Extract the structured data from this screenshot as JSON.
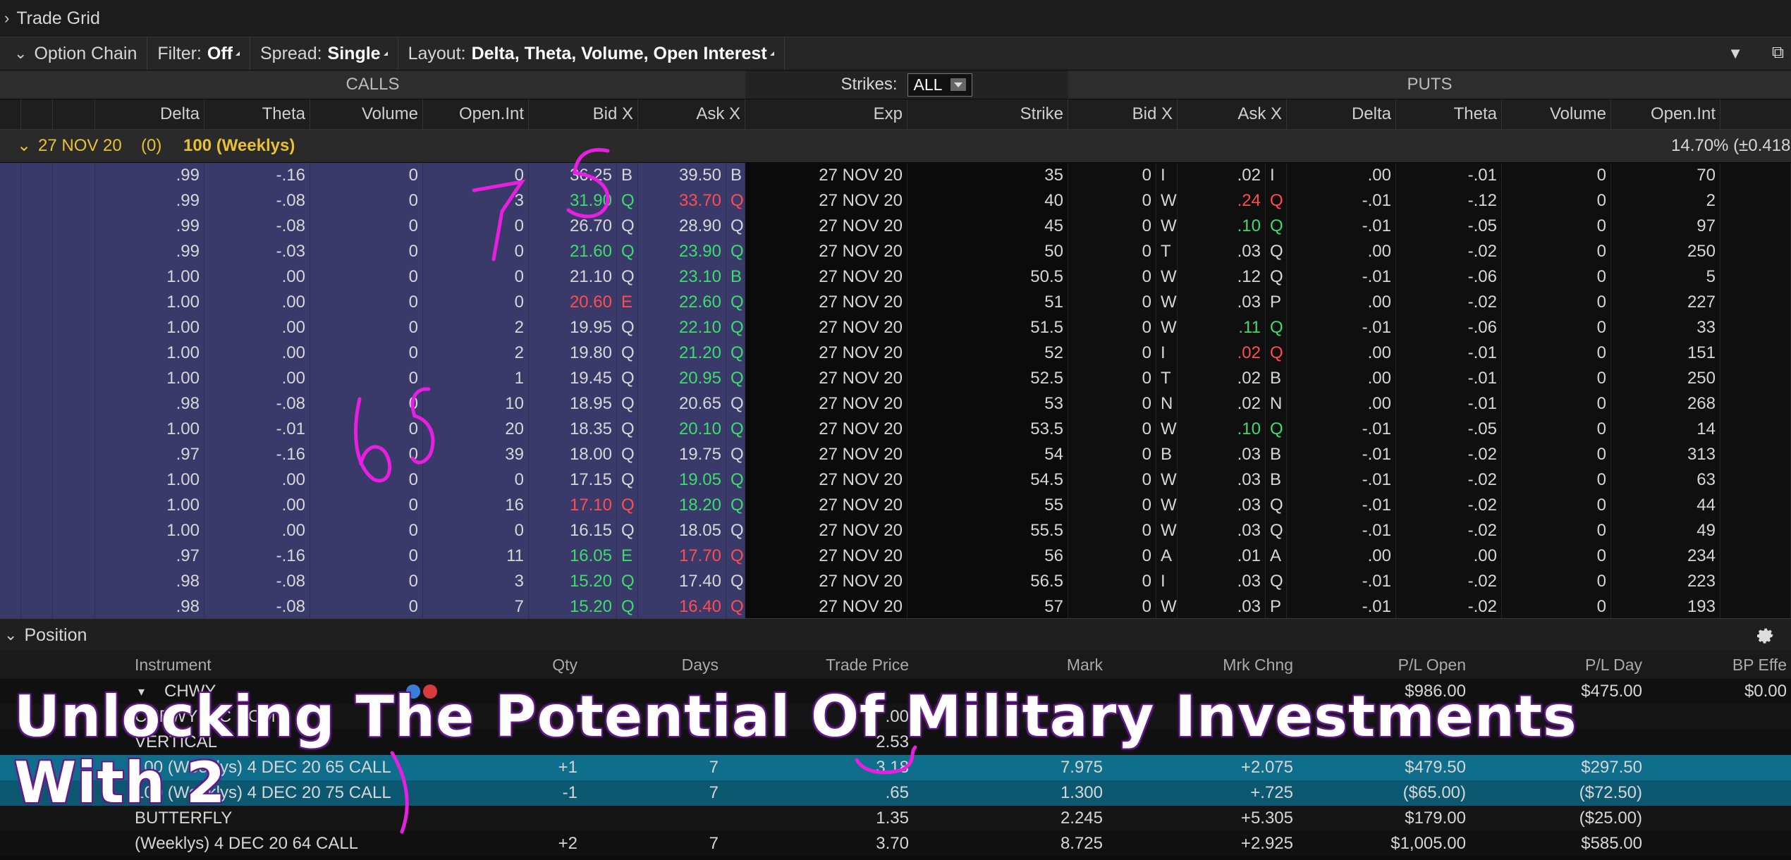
{
  "trade_grid": {
    "title": "Trade Grid"
  },
  "chain_bar": {
    "title": "Option Chain",
    "filter_label": "Filter:",
    "filter_value": "Off",
    "spread_label": "Spread:",
    "spread_value": "Single",
    "layout_label": "Layout:",
    "layout_value": "Delta, Theta, Volume, Open Interest"
  },
  "calls_label": "CALLS",
  "puts_label": "PUTS",
  "strikes_label": "Strikes:",
  "strikes_value": "ALL",
  "columns": {
    "call_delta": "Delta",
    "call_theta": "Theta",
    "call_volume": "Volume",
    "call_oi": "Open.Int",
    "bid": "Bid X",
    "ask": "Ask X",
    "exp": "Exp",
    "strike": "Strike",
    "put_bid": "Bid X",
    "put_ask": "Ask X",
    "put_delta": "Delta",
    "put_theta": "Theta",
    "put_volume": "Volume",
    "put_oi": "Open.Int"
  },
  "series": {
    "date": "27 NOV 20",
    "count": "(0)",
    "label": "100 (Weeklys)",
    "iv": "14.70% (±0.418"
  },
  "rows": [
    {
      "cd": ".99",
      "ct": "-.16",
      "cv": "0",
      "co": "0",
      "bid": "36.25",
      "bx": "B",
      "ask": "39.50",
      "ax": "B",
      "exp": "27 NOV 20",
      "strike": "35",
      "pb": "0",
      "pbx": "I",
      "pa": ".02",
      "pax": "I",
      "pd": ".00",
      "pt": "-.01",
      "pv": "0",
      "po": "70"
    },
    {
      "cd": ".99",
      "ct": "-.08",
      "cv": "0",
      "co": "3",
      "bid": "31.90",
      "bx": "Q",
      "ask": "33.70",
      "ax": "Q",
      "exp": "27 NOV 20",
      "strike": "40",
      "pb": "0",
      "pbx": "W",
      "pa": ".24",
      "pax": "Q",
      "pd": "-.01",
      "pt": "-.12",
      "pv": "0",
      "po": "2"
    },
    {
      "cd": ".99",
      "ct": "-.08",
      "cv": "0",
      "co": "0",
      "bid": "26.70",
      "bx": "Q",
      "ask": "28.90",
      "ax": "Q",
      "exp": "27 NOV 20",
      "strike": "45",
      "pb": "0",
      "pbx": "W",
      "pa": ".10",
      "pax": "Q",
      "pd": "-.01",
      "pt": "-.05",
      "pv": "0",
      "po": "97"
    },
    {
      "cd": ".99",
      "ct": "-.03",
      "cv": "0",
      "co": "0",
      "bid": "21.60",
      "bx": "Q",
      "ask": "23.90",
      "ax": "Q",
      "exp": "27 NOV 20",
      "strike": "50",
      "pb": "0",
      "pbx": "T",
      "pa": ".03",
      "pax": "Q",
      "pd": ".00",
      "pt": "-.02",
      "pv": "0",
      "po": "250"
    },
    {
      "cd": "1.00",
      "ct": ".00",
      "cv": "0",
      "co": "0",
      "bid": "21.10",
      "bx": "Q",
      "ask": "23.10",
      "ax": "B",
      "exp": "27 NOV 20",
      "strike": "50.5",
      "pb": "0",
      "pbx": "W",
      "pa": ".12",
      "pax": "Q",
      "pd": "-.01",
      "pt": "-.06",
      "pv": "0",
      "po": "5"
    },
    {
      "cd": "1.00",
      "ct": ".00",
      "cv": "0",
      "co": "0",
      "bid": "20.60",
      "bx": "E",
      "ask": "22.60",
      "ax": "Q",
      "exp": "27 NOV 20",
      "strike": "51",
      "pb": "0",
      "pbx": "W",
      "pa": ".03",
      "pax": "P",
      "pd": ".00",
      "pt": "-.02",
      "pv": "0",
      "po": "227"
    },
    {
      "cd": "1.00",
      "ct": ".00",
      "cv": "0",
      "co": "2",
      "bid": "19.95",
      "bx": "Q",
      "ask": "22.10",
      "ax": "Q",
      "exp": "27 NOV 20",
      "strike": "51.5",
      "pb": "0",
      "pbx": "W",
      "pa": ".11",
      "pax": "Q",
      "pd": "-.01",
      "pt": "-.06",
      "pv": "0",
      "po": "33"
    },
    {
      "cd": "1.00",
      "ct": ".00",
      "cv": "0",
      "co": "2",
      "bid": "19.80",
      "bx": "Q",
      "ask": "21.20",
      "ax": "Q",
      "exp": "27 NOV 20",
      "strike": "52",
      "pb": "0",
      "pbx": "I",
      "pa": ".02",
      "pax": "Q",
      "pd": ".00",
      "pt": "-.01",
      "pv": "0",
      "po": "151"
    },
    {
      "cd": "1.00",
      "ct": ".00",
      "cv": "0",
      "co": "1",
      "bid": "19.45",
      "bx": "Q",
      "ask": "20.95",
      "ax": "Q",
      "exp": "27 NOV 20",
      "strike": "52.5",
      "pb": "0",
      "pbx": "T",
      "pa": ".02",
      "pax": "B",
      "pd": ".00",
      "pt": "-.01",
      "pv": "0",
      "po": "250"
    },
    {
      "cd": ".98",
      "ct": "-.08",
      "cv": "0",
      "co": "10",
      "bid": "18.95",
      "bx": "Q",
      "ask": "20.65",
      "ax": "Q",
      "exp": "27 NOV 20",
      "strike": "53",
      "pb": "0",
      "pbx": "N",
      "pa": ".02",
      "pax": "N",
      "pd": ".00",
      "pt": "-.01",
      "pv": "0",
      "po": "268"
    },
    {
      "cd": "1.00",
      "ct": "-.01",
      "cv": "0",
      "co": "20",
      "bid": "18.35",
      "bx": "Q",
      "ask": "20.10",
      "ax": "Q",
      "exp": "27 NOV 20",
      "strike": "53.5",
      "pb": "0",
      "pbx": "W",
      "pa": ".10",
      "pax": "Q",
      "pd": "-.01",
      "pt": "-.05",
      "pv": "0",
      "po": "14"
    },
    {
      "cd": ".97",
      "ct": "-.16",
      "cv": "0",
      "co": "39",
      "bid": "18.00",
      "bx": "Q",
      "ask": "19.75",
      "ax": "Q",
      "exp": "27 NOV 20",
      "strike": "54",
      "pb": "0",
      "pbx": "B",
      "pa": ".03",
      "pax": "B",
      "pd": "-.01",
      "pt": "-.02",
      "pv": "0",
      "po": "313"
    },
    {
      "cd": "1.00",
      "ct": ".00",
      "cv": "0",
      "co": "0",
      "bid": "17.15",
      "bx": "Q",
      "ask": "19.05",
      "ax": "Q",
      "exp": "27 NOV 20",
      "strike": "54.5",
      "pb": "0",
      "pbx": "W",
      "pa": ".03",
      "pax": "B",
      "pd": "-.01",
      "pt": "-.02",
      "pv": "0",
      "po": "63"
    },
    {
      "cd": "1.00",
      "ct": ".00",
      "cv": "0",
      "co": "16",
      "bid": "17.10",
      "bx": "Q",
      "ask": "18.20",
      "ax": "Q",
      "exp": "27 NOV 20",
      "strike": "55",
      "pb": "0",
      "pbx": "W",
      "pa": ".03",
      "pax": "Q",
      "pd": "-.01",
      "pt": "-.02",
      "pv": "0",
      "po": "44"
    },
    {
      "cd": "1.00",
      "ct": ".00",
      "cv": "0",
      "co": "0",
      "bid": "16.15",
      "bx": "Q",
      "ask": "18.05",
      "ax": "Q",
      "exp": "27 NOV 20",
      "strike": "55.5",
      "pb": "0",
      "pbx": "W",
      "pa": ".03",
      "pax": "Q",
      "pd": "-.01",
      "pt": "-.02",
      "pv": "0",
      "po": "49"
    },
    {
      "cd": ".97",
      "ct": "-.16",
      "cv": "0",
      "co": "11",
      "bid": "16.05",
      "bx": "E",
      "ask": "17.70",
      "ax": "Q",
      "exp": "27 NOV 20",
      "strike": "56",
      "pb": "0",
      "pbx": "A",
      "pa": ".01",
      "pax": "A",
      "pd": ".00",
      "pt": ".00",
      "pv": "0",
      "po": "234"
    },
    {
      "cd": ".98",
      "ct": "-.08",
      "cv": "0",
      "co": "3",
      "bid": "15.20",
      "bx": "Q",
      "ask": "17.40",
      "ax": "Q",
      "exp": "27 NOV 20",
      "strike": "56.5",
      "pb": "0",
      "pbx": "I",
      "pa": ".03",
      "pax": "Q",
      "pd": "-.01",
      "pt": "-.02",
      "pv": "0",
      "po": "223"
    },
    {
      "cd": ".98",
      "ct": "-.08",
      "cv": "0",
      "co": "7",
      "bid": "15.20",
      "bx": "Q",
      "ask": "16.40",
      "ax": "Q",
      "exp": "27 NOV 20",
      "strike": "57",
      "pb": "0",
      "pbx": "W",
      "pa": ".03",
      "pax": "P",
      "pd": "-.01",
      "pt": "-.02",
      "pv": "0",
      "po": "193"
    }
  ],
  "position": {
    "title": "Position",
    "headers": {
      "instrument": "Instrument",
      "qty": "Qty",
      "days": "Days",
      "trade_price": "Trade Price",
      "mark": "Mark",
      "mrk_chng": "Mrk Chng",
      "pl_open": "P/L Open",
      "pl_day": "P/L Day",
      "bp": "BP Effe"
    },
    "rows": [
      {
        "instrument": "CHWY",
        "qty": "",
        "days": "",
        "trade_price": "",
        "mark": "",
        "mrk_chng": "",
        "pl_open": "$986.00",
        "pl_day": "$475.00",
        "bp": "$0.00"
      },
      {
        "instrument": "CHEWY INC COM",
        "qty": "",
        "days": "",
        "trade_price": ".00",
        "mark": "",
        "mrk_chng": "",
        "pl_open": "",
        "pl_day": "",
        "bp": ""
      },
      {
        "instrument": "VERTICAL",
        "qty": "",
        "days": "",
        "trade_price": "2.53",
        "mark": "",
        "mrk_chng": "",
        "pl_open": "",
        "pl_day": "",
        "bp": ""
      },
      {
        "instrument": "100 (Weeklys) 4 DEC 20 65 CALL",
        "qty": "+1",
        "days": "7",
        "trade_price": "3.18",
        "mark": "7.975",
        "mrk_chng": "+2.075",
        "pl_open": "$479.50",
        "pl_day": "$297.50",
        "bp": ""
      },
      {
        "instrument": "100 (Weeklys) 4 DEC 20 75 CALL",
        "qty": "-1",
        "days": "7",
        "trade_price": ".65",
        "mark": "1.300",
        "mrk_chng": "+.725",
        "pl_open": "($65.00)",
        "pl_day": "($72.50)",
        "bp": ""
      },
      {
        "instrument": "BUTTERFLY",
        "qty": "",
        "days": "",
        "trade_price": "1.35",
        "mark": "2.245",
        "mrk_chng": "+5.305",
        "pl_open": "$179.00",
        "pl_day": "($25.00)",
        "bp": ""
      },
      {
        "instrument": "(Weeklys) 4 DEC 20 64 CALL",
        "qty": "+2",
        "days": "7",
        "trade_price": "3.70",
        "mark": "8.725",
        "mrk_chng": "+2.925",
        "pl_open": "$1,005.00",
        "pl_day": "$585.00",
        "bp": ""
      }
    ]
  },
  "overlay": {
    "line1": "Unlocking The Potential Of Military Investments",
    "line2": "With 2"
  },
  "colors": {
    "calls_bg": "#3a3a6a",
    "bid_up": "#3ddc6b",
    "down": "#ff4d4d",
    "series": "#e8c133",
    "highlight": "#0e6e8c",
    "scribble": "#e81ee0"
  }
}
